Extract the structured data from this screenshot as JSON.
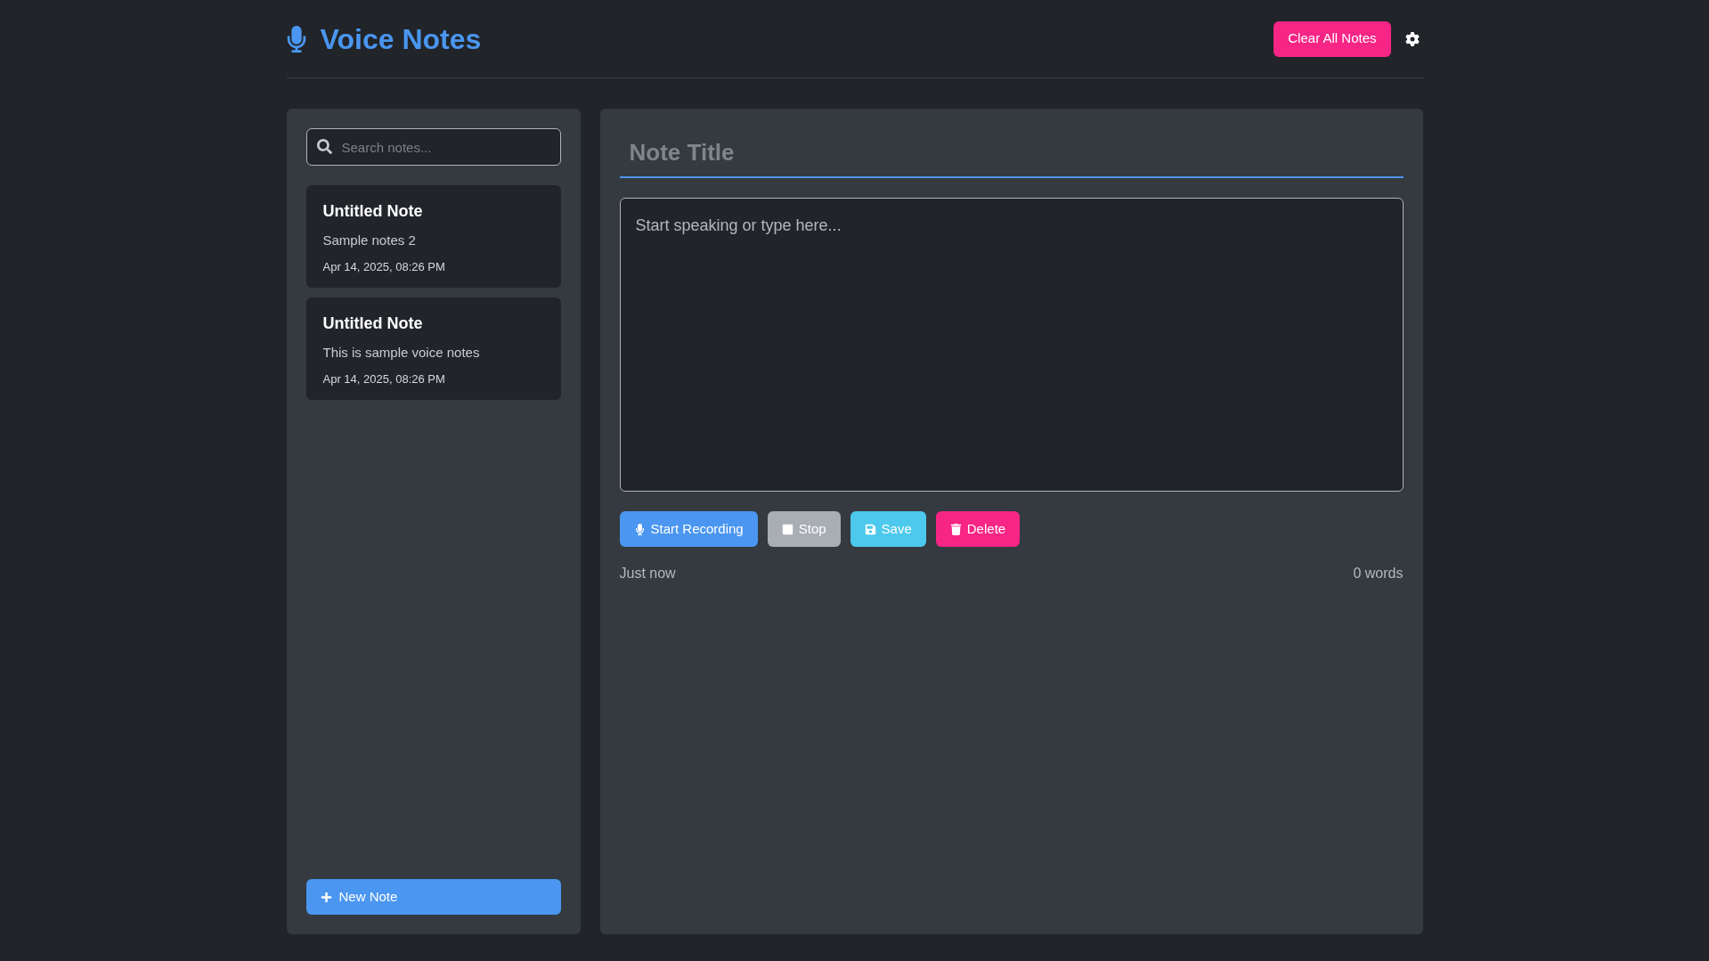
{
  "header": {
    "title": "Voice Notes",
    "clear_button": "Clear All Notes"
  },
  "sidebar": {
    "search": {
      "placeholder": "Search notes..."
    },
    "notes": [
      {
        "title": "Untitled Note",
        "preview": "Sample notes 2",
        "date": "Apr 14, 2025, 08:26 PM"
      },
      {
        "title": "Untitled Note",
        "preview": "This is sample voice notes",
        "date": "Apr 14, 2025, 08:26 PM"
      }
    ],
    "new_button": "New Note"
  },
  "editor": {
    "title_placeholder": "Note Title",
    "body_placeholder": "Start speaking or type here...",
    "buttons": [
      {
        "label": "Start Recording",
        "kind": "record"
      },
      {
        "label": "Stop",
        "kind": "stop"
      },
      {
        "label": "Save",
        "kind": "save"
      },
      {
        "label": "Delete",
        "kind": "delete"
      }
    ],
    "status": "Just now",
    "word_count": "0 words"
  }
}
